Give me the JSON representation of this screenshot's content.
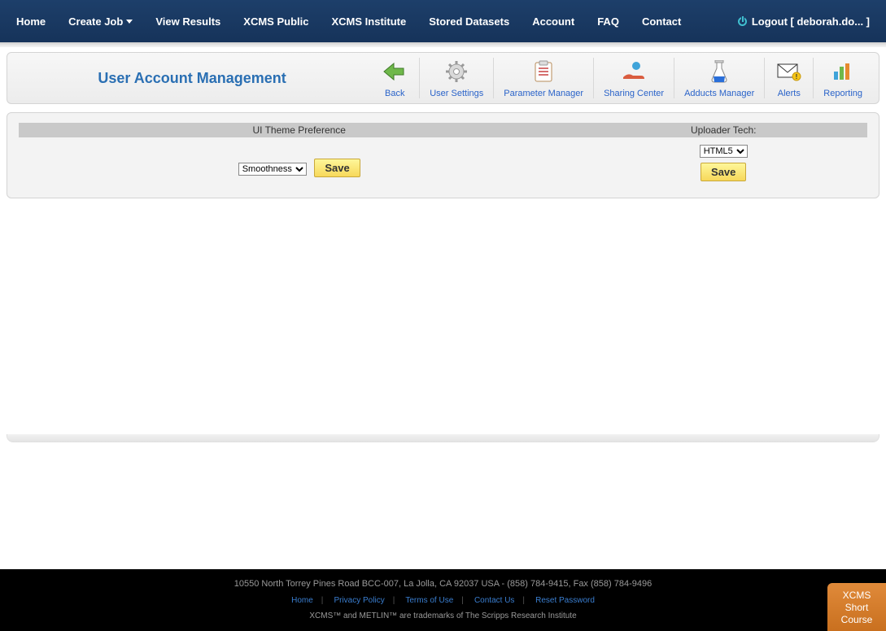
{
  "nav": {
    "items": [
      {
        "label": "Home"
      },
      {
        "label": "Create Job",
        "dropdown": true
      },
      {
        "label": "View Results"
      },
      {
        "label": "XCMS Public"
      },
      {
        "label": "XCMS Institute"
      },
      {
        "label": "Stored Datasets"
      },
      {
        "label": "Account"
      },
      {
        "label": "FAQ"
      },
      {
        "label": "Contact"
      }
    ],
    "logout_label": "Logout [ deborah.do... ]"
  },
  "panel": {
    "title": "User Account Management",
    "toolbar": [
      {
        "label": "Back",
        "icon": "arrow-left-icon"
      },
      {
        "label": "User Settings",
        "icon": "gear-icon"
      },
      {
        "label": "Parameter Manager",
        "icon": "clipboard-icon"
      },
      {
        "label": "Sharing Center",
        "icon": "hand-share-icon"
      },
      {
        "label": "Adducts Manager",
        "icon": "flask-icon"
      },
      {
        "label": "Alerts",
        "icon": "envelope-alert-icon"
      },
      {
        "label": "Reporting",
        "icon": "bar-chart-icon"
      }
    ]
  },
  "prefs": {
    "theme": {
      "header": "UI Theme Preference",
      "selected": "Smoothness",
      "save_label": "Save"
    },
    "uploader": {
      "header": "Uploader Tech:",
      "selected": "HTML5",
      "save_label": "Save"
    }
  },
  "footer": {
    "address": "10550 North Torrey Pines Road BCC-007, La Jolla, CA 92037 USA - (858) 784-9415, Fax (858) 784-9496",
    "links": [
      "Home",
      "Privacy Policy",
      "Terms of Use",
      "Contact Us",
      "Reset Password"
    ],
    "trademark": "XCMS™ and METLIN™ are trademarks of The Scripps Research Institute"
  },
  "corner_tab": {
    "line1": "XCMS",
    "line2": "Short",
    "line3": "Course"
  }
}
